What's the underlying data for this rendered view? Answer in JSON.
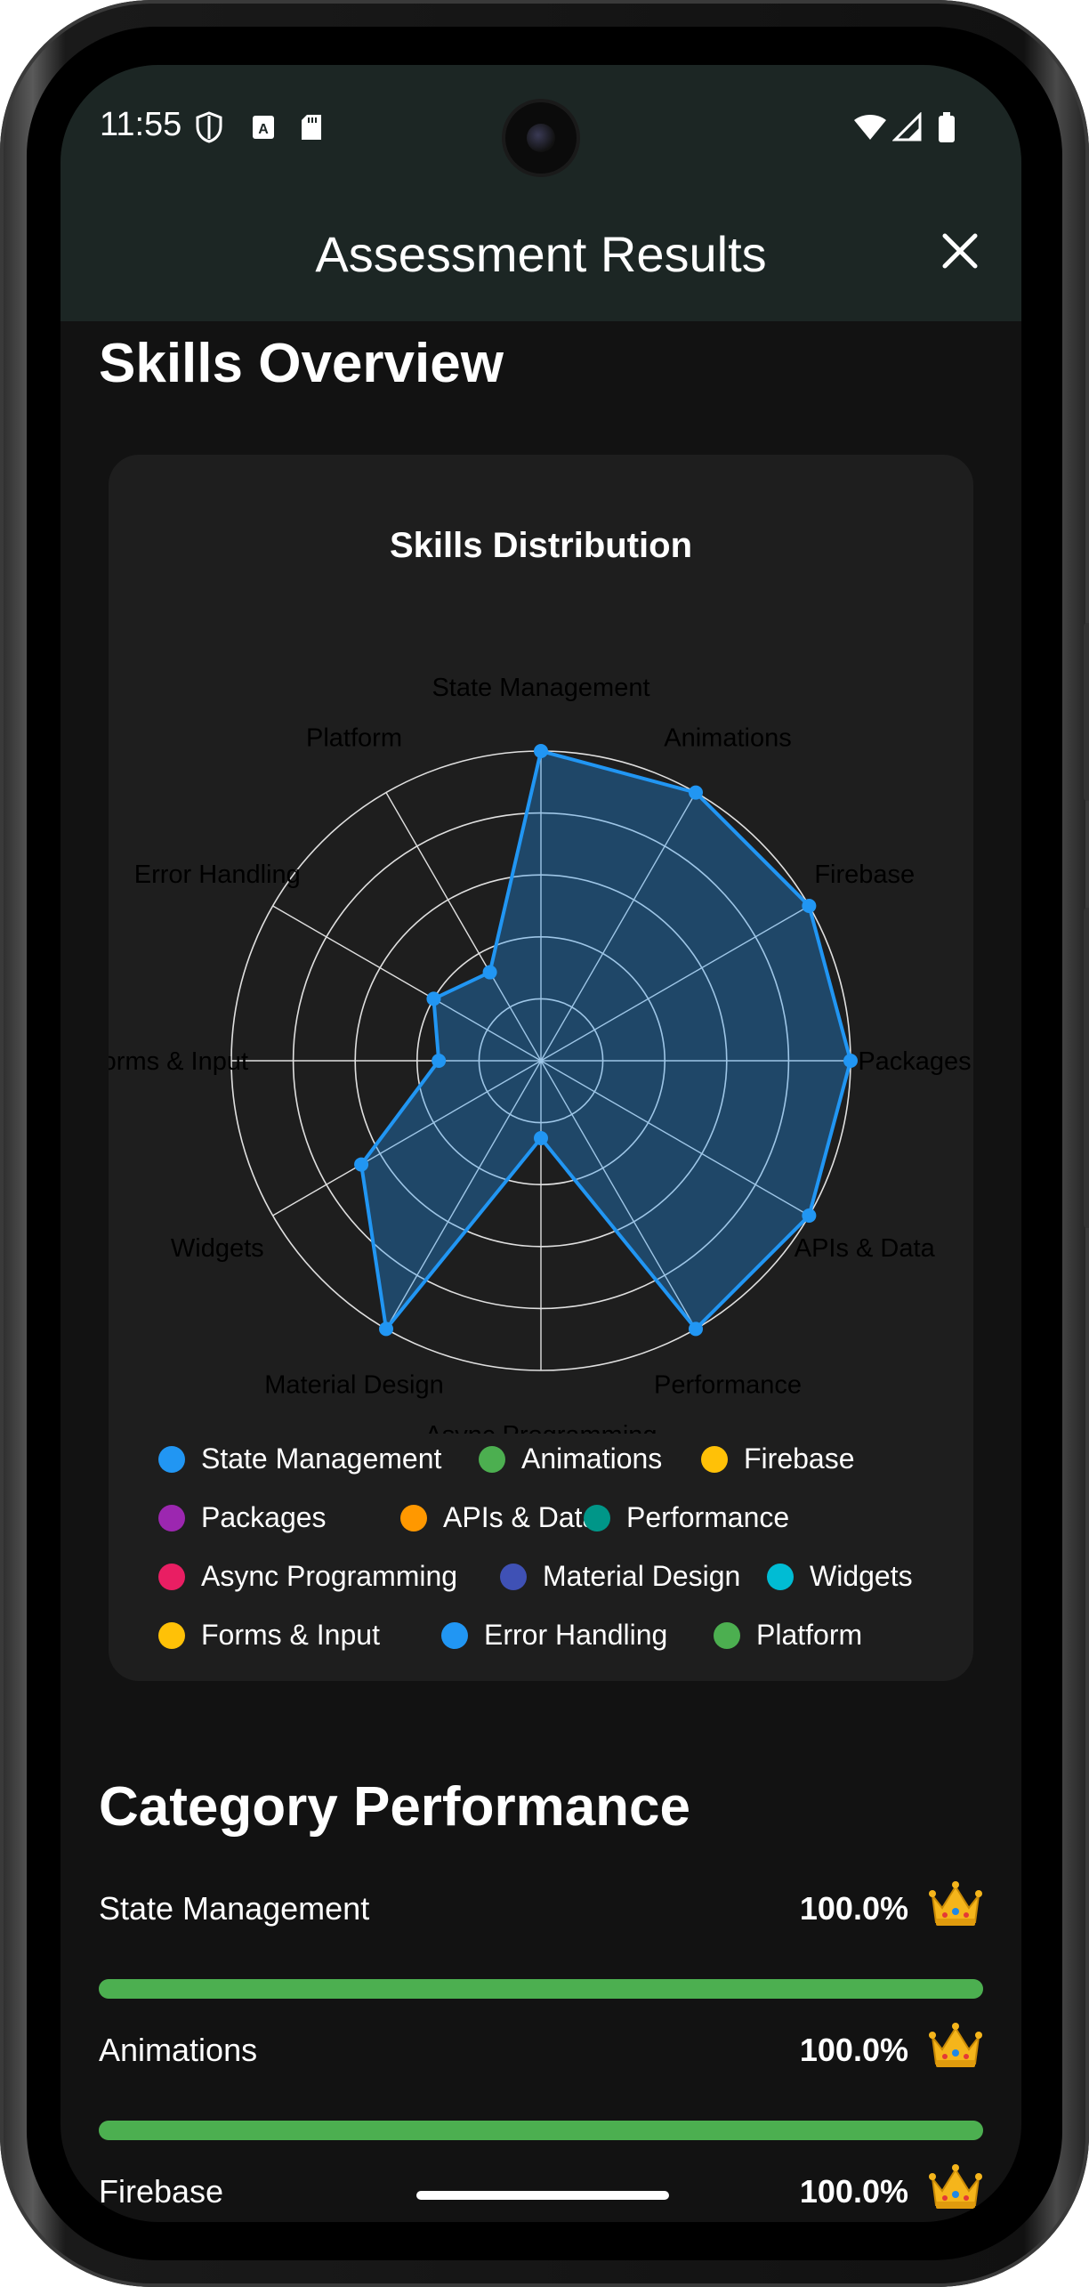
{
  "status_bar": {
    "time": "11:55"
  },
  "app_bar": {
    "title": "Assessment Results"
  },
  "skills_overview": {
    "heading": "Skills Overview"
  },
  "chart_card": {
    "title": "Skills Distribution"
  },
  "chart_data": {
    "type": "radar",
    "title": "Skills Distribution",
    "axes": [
      "State Management",
      "Animations",
      "Firebase",
      "Packages",
      "APIs & Data",
      "Performance",
      "Async Programming",
      "Material Design",
      "Widgets",
      "Forms & Input",
      "Error Handling",
      "Platform"
    ],
    "values": [
      100,
      100,
      100,
      100,
      100,
      100,
      25,
      100,
      67,
      33,
      40,
      33
    ],
    "rlim": [
      0,
      100
    ],
    "grid_rings": 5,
    "color": "#2196f3",
    "fill": "rgba(33,150,243,0.35)"
  },
  "legend": [
    [
      {
        "label": "State Management",
        "color": "#2196f3"
      },
      {
        "label": "Animations",
        "color": "#4caf50"
      },
      {
        "label": "Firebase",
        "color": "#ffc107"
      }
    ],
    [
      {
        "label": "Packages",
        "color": "#9c27b0"
      },
      {
        "label": "APIs & Data",
        "color": "#ff9800"
      },
      {
        "label": "Performance",
        "color": "#009688"
      }
    ],
    [
      {
        "label": "Async Programming",
        "color": "#e91e63"
      },
      {
        "label": "Material Design",
        "color": "#3f51b5"
      },
      {
        "label": "Widgets",
        "color": "#00bcd4"
      }
    ],
    [
      {
        "label": "Forms & Input",
        "color": "#ffc107"
      },
      {
        "label": "Error Handling",
        "color": "#2196f3"
      },
      {
        "label": "Platform",
        "color": "#4caf50"
      }
    ]
  ],
  "category_performance": {
    "heading": "Category Performance",
    "items": [
      {
        "label": "State Management",
        "value": "100.0%",
        "fraction": 1.0,
        "icon": "crown-icon"
      },
      {
        "label": "Animations",
        "value": "100.0%",
        "fraction": 1.0,
        "icon": "crown-icon"
      },
      {
        "label": "Firebase",
        "value": "100.0%",
        "fraction": 1.0,
        "icon": "crown-icon"
      }
    ]
  },
  "colors": {
    "app_bar": "#1c2624",
    "background": "#121212",
    "card": "#1e1e1e",
    "progress": "#4caf50",
    "accent": "#2196f3"
  }
}
